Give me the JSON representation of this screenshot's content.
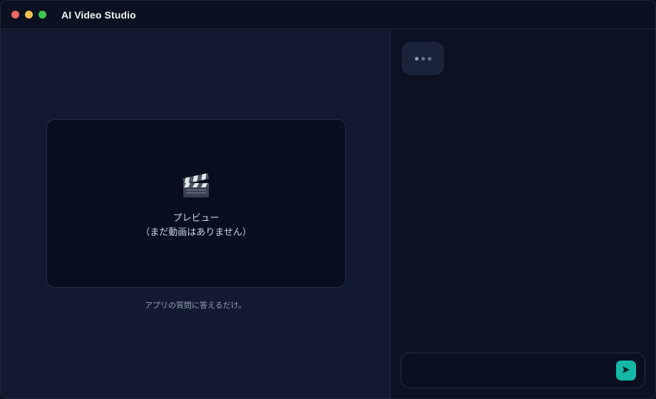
{
  "window": {
    "title": "AI Video Studio"
  },
  "preview": {
    "icon": "clapperboard-icon",
    "title": "プレビュー",
    "subtitle": "（まだ動画はありません）"
  },
  "caption": "アプリの質問に答えるだけ。",
  "chat": {
    "typing_indicator": "typing-dots",
    "input_value": "",
    "input_placeholder": "",
    "send_icon": "send-icon"
  },
  "colors": {
    "accent": "#14b8a6",
    "background": "#0c1222",
    "panel": "#111a2e"
  }
}
